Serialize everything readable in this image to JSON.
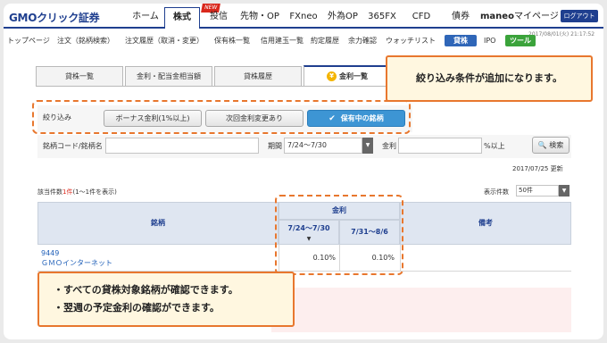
{
  "header": {
    "logo": "GMOクリック証券",
    "nav": [
      "ホーム",
      "株式",
      "投信",
      "先物・OP",
      "FXneo",
      "外為OP",
      "365FX",
      "CFD",
      "債券",
      "maneo",
      "マイページ"
    ],
    "new_badge": "NEW",
    "login": "ログアウト",
    "timestamp": "2017/08/01(火) 21:17:52"
  },
  "subnav": {
    "items": [
      "トップページ",
      "注文（銘柄検索）",
      "注文履歴（取消・変更）",
      "保有株一覧",
      "信用建玉一覧",
      "約定履歴",
      "余力確認",
      "ウォッチリスト"
    ],
    "badges": [
      "貸株",
      "IPO",
      "ツール"
    ]
  },
  "tabs": [
    "貸株一覧",
    "金利・配当金相当額",
    "貸株履歴",
    "金利一覧"
  ],
  "callouts": {
    "top": "絞り込み条件が追加になります。",
    "bottom_line1": "・すべての貸株対象銘柄が確認できます。",
    "bottom_line2": "・翌週の予定金利の確認ができます。"
  },
  "filter": {
    "label": "絞り込み",
    "buttons": [
      "ボーナス金利(1%以上)",
      "次回金利変更あり",
      "保有中の銘柄"
    ]
  },
  "search": {
    "code_label": "銘柄コード/銘柄名",
    "code_value": "",
    "period_label": "期間",
    "period_value": "7/24～7/30",
    "rate_label": "金利",
    "rate_value": "",
    "rate_suffix": "%以上",
    "button": "検索"
  },
  "updated": "2017/07/25 更新",
  "results": {
    "prefix": "該当件数",
    "count": "1件",
    "suffix": "(1～1件を表示)",
    "per_page_label": "表示件数",
    "per_page_value": "50件"
  },
  "table": {
    "col_stock": "銘柄",
    "col_rate": "金利",
    "col_week1": "7/24～7/30",
    "col_week2": "7/31～8/6",
    "col_note": "備考",
    "sort_mark": "▼",
    "rows": [
      {
        "code": "9449",
        "name": "ＧＭＯインターネット",
        "rate1": "0.10%",
        "rate2": "0.10%",
        "note": ""
      }
    ]
  },
  "colors": {
    "brand": "#1f3f8f",
    "accent_orange": "#e8772e",
    "callout_bg": "#fff7e0",
    "button_on": "#3d95d4"
  }
}
